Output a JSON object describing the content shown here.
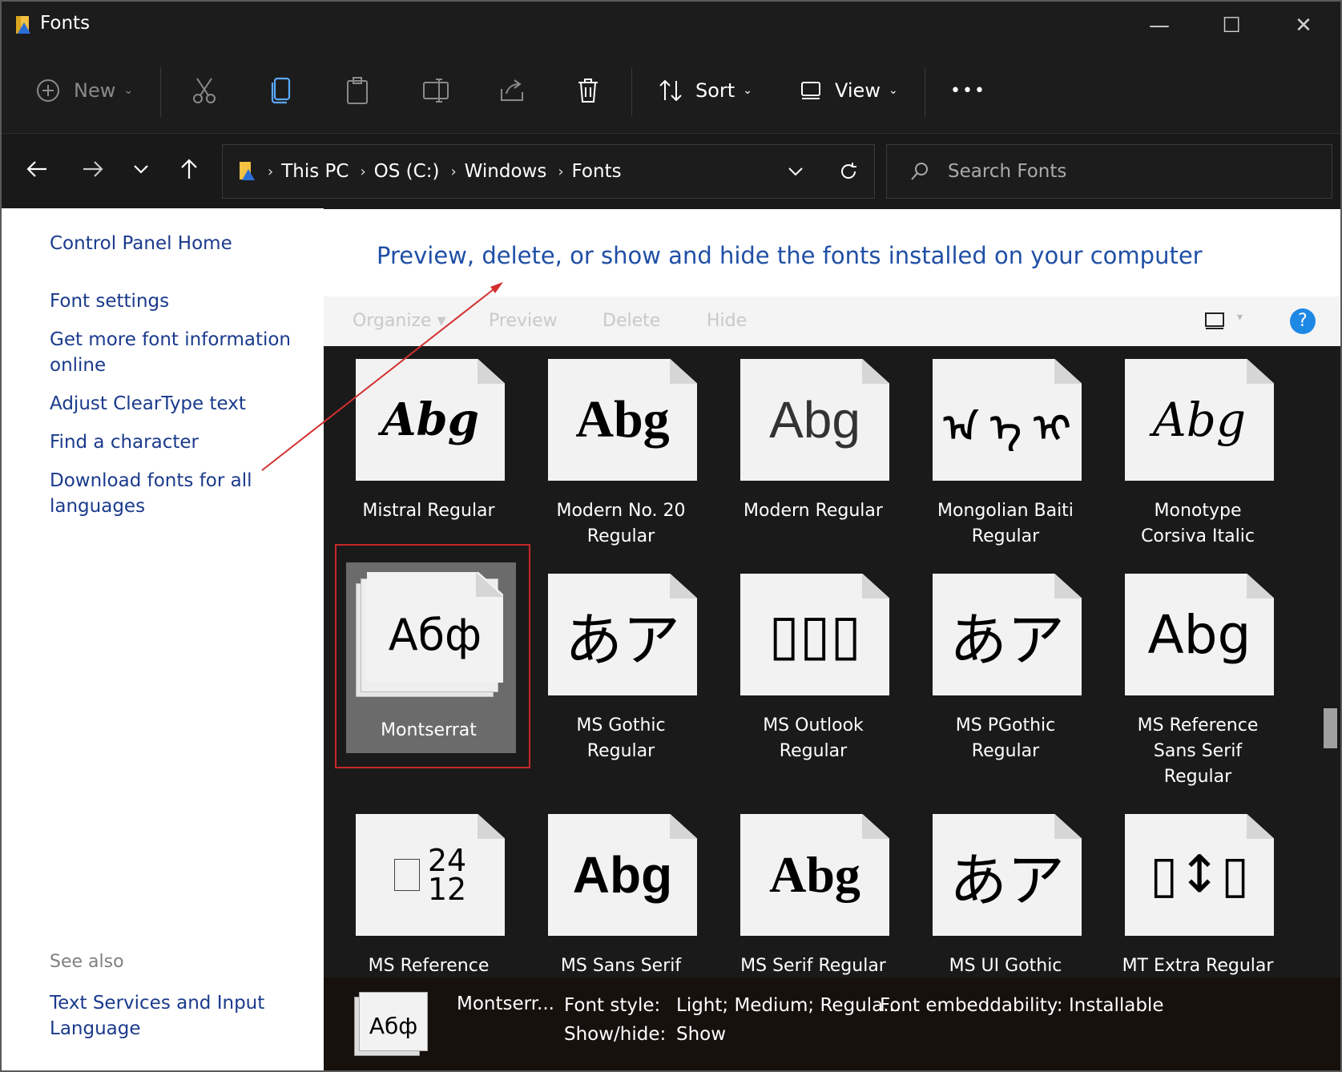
{
  "window": {
    "title": "Fonts",
    "controls": {
      "minimize": "—",
      "maximize": "☐",
      "close": "✕"
    }
  },
  "toolbar": {
    "new_label": "New",
    "sort_label": "Sort",
    "view_label": "View",
    "more_label": "•••"
  },
  "address": {
    "crumbs": [
      "This PC",
      "OS (C:)",
      "Windows",
      "Fonts"
    ],
    "search_placeholder": "Search Fonts"
  },
  "left_pane": {
    "links": [
      "Control Panel Home",
      "Font settings",
      "Get more font information online",
      "Adjust ClearType text",
      "Find a character",
      "Download fonts for all languages"
    ],
    "link_lines": {
      "get_more_1": "Get more font information",
      "get_more_2": "online",
      "download_1": "Download fonts for all",
      "download_2": "languages"
    },
    "see_also": "See also",
    "text_services_1": "Text Services and Input",
    "text_services_2": "Language"
  },
  "heading": "Preview, delete, or show and hide the fonts installed on your computer",
  "organize_bar": {
    "organize": "Organize ▾",
    "preview": "Preview",
    "delete": "Delete",
    "hide": "Hide",
    "help": "?"
  },
  "fonts": [
    {
      "name1": "Mistral Regular",
      "name2": "",
      "glyph": "Abg"
    },
    {
      "name1": "Modern No. 20",
      "name2": "Regular",
      "glyph": "Abg"
    },
    {
      "name1": "Modern Regular",
      "name2": "",
      "glyph": "Abg"
    },
    {
      "name1": "Mongolian Baiti",
      "name2": "Regular",
      "glyph": "ᠠ ᠡ ᠢ"
    },
    {
      "name1": "Monotype",
      "name2": "Corsiva Italic",
      "glyph": "Abg"
    },
    {
      "name1": "Montserrat",
      "name2": "",
      "glyph": "Абф"
    },
    {
      "name1": "MS Gothic",
      "name2": "Regular",
      "glyph": "あア"
    },
    {
      "name1": "MS Outlook",
      "name2": "Regular",
      "glyph": "▯▯▯"
    },
    {
      "name1": "MS PGothic",
      "name2": "Regular",
      "glyph": "あア"
    },
    {
      "name1": "MS Reference",
      "name2": "Sans Serif",
      "name3": "Regular",
      "glyph": "Abg"
    },
    {
      "name1": "MS Reference",
      "name2": "",
      "glyph": "24 12"
    },
    {
      "name1": "MS Sans Serif",
      "name2": "",
      "glyph": "Abg"
    },
    {
      "name1": "MS Serif Regular",
      "name2": "",
      "glyph": "Abg"
    },
    {
      "name1": "MS UI Gothic",
      "name2": "",
      "glyph": "あア"
    },
    {
      "name1": "MT Extra Regular",
      "name2": "",
      "glyph": "▯↕▯"
    }
  ],
  "glyph_parts": {
    "ms_ref_top": "24",
    "ms_ref_bottom": "12"
  },
  "details": {
    "name": "Montserr...",
    "font_style_label": "Font style:",
    "font_style_value": "Light; Medium; Regula...",
    "embed_label": "Font embeddability:",
    "embed_value": "Installable",
    "showhide_label": "Show/hide:",
    "showhide_value": "Show",
    "thumb_glyph": "Абф"
  },
  "colors": {
    "dark_bg": "#1c1c1c",
    "link": "#1a3a8c",
    "heading": "#1f4fa6",
    "selection_border": "#c62828",
    "help_blue": "#1e88e5",
    "annotation_arrow": "#d32f2f"
  }
}
